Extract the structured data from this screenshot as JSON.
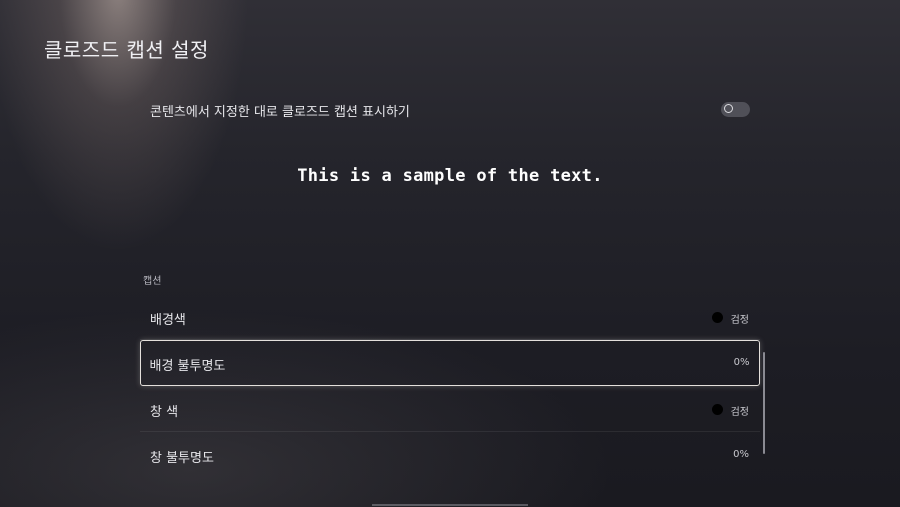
{
  "header": {
    "title": "클로즈드 캡션 설정"
  },
  "toggle_setting": {
    "label": "콘텐츠에서 지정한 대로 클로즈드 캡션 표시하기",
    "state": "off"
  },
  "preview": {
    "sample_text": "This is a sample of the text."
  },
  "section": {
    "label": "캡션"
  },
  "settings": [
    {
      "label": "배경색",
      "value": "검정",
      "swatch_color": "#000000",
      "focused": false
    },
    {
      "label": "배경 불투명도",
      "value": "0%",
      "focused": true
    },
    {
      "label": "창 색",
      "value": "검정",
      "swatch_color": "#000000",
      "focused": false
    },
    {
      "label": "창 불투명도",
      "value": "0%",
      "focused": false
    }
  ],
  "colors": {
    "focus_border": "#e4e0dc",
    "toggle_off": "#505058"
  }
}
